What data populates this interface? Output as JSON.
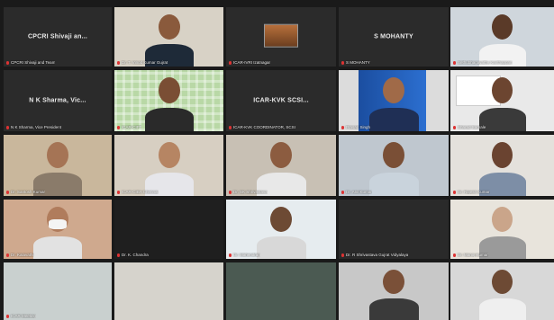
{
  "meeting": {
    "participants": [
      {
        "display_name": "CPCRI Shivaji an...",
        "caption": "CPCRI Shivaji and Team",
        "mode": "name"
      },
      {
        "display_name": "",
        "caption": "Dr. T. Vinod Kumar Gujrat",
        "mode": "video"
      },
      {
        "display_name": "",
        "caption": "ICAR-IVRI Izatnagar",
        "mode": "video"
      },
      {
        "display_name": "S MOHANTY",
        "caption": "S MOHANTY",
        "mode": "name"
      },
      {
        "display_name": "",
        "caption": "Sethubhagavathy Kanthappan",
        "mode": "video"
      },
      {
        "display_name": "N K Sharma, Vic...",
        "caption": "N K Sharma, Vice President",
        "mode": "name"
      },
      {
        "display_name": "",
        "caption": "ICAR-CIFT",
        "mode": "video"
      },
      {
        "display_name": "ICAR-KVK SCSI...",
        "caption": "ICAR-KVK COORDINATOR, SCSI",
        "mode": "name"
      },
      {
        "display_name": "",
        "caption": "Prasad Singh",
        "mode": "video"
      },
      {
        "display_name": "",
        "caption": "Sharad Sarnale",
        "mode": "video"
      },
      {
        "display_name": "",
        "caption": "Dr. Santosh Kumar",
        "mode": "video"
      },
      {
        "display_name": "",
        "caption": "ICAR-CIBA Chennai",
        "mode": "video"
      },
      {
        "display_name": "",
        "caption": "Dr. SK Shrivastava",
        "mode": "video"
      },
      {
        "display_name": "",
        "caption": "Dr. Anil Kumar",
        "mode": "video"
      },
      {
        "display_name": "",
        "caption": "Dr. Rajesh Kumar",
        "mode": "video"
      },
      {
        "display_name": "",
        "caption": "Dr. Kalavathi",
        "mode": "video"
      },
      {
        "display_name": "",
        "caption": "Dr. K. Chandra",
        "mode": "video"
      },
      {
        "display_name": "",
        "caption": "Dr. Mahendran",
        "mode": "video"
      },
      {
        "display_name": "",
        "caption": "Dr. R Shrivastava Gujrat Vidyalaya",
        "mode": "video"
      },
      {
        "display_name": "",
        "caption": "Dr. Manoj Kumar",
        "mode": "video"
      },
      {
        "display_name": "",
        "caption": "ICAR Meeting",
        "mode": "video"
      },
      {
        "display_name": "",
        "caption": "",
        "mode": "video"
      },
      {
        "display_name": "",
        "caption": "",
        "mode": "video"
      },
      {
        "display_name": "",
        "caption": "",
        "mode": "video"
      },
      {
        "display_name": "",
        "caption": "",
        "mode": "video"
      }
    ]
  }
}
